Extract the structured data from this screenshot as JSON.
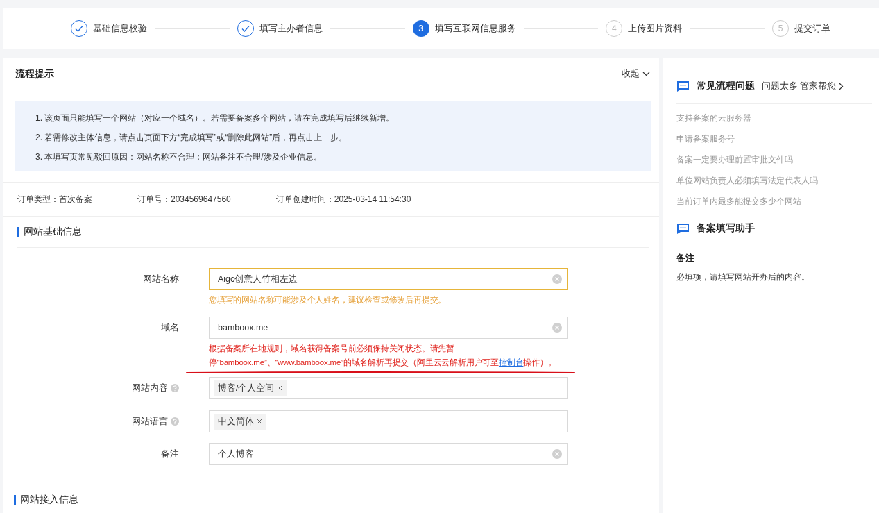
{
  "steps": [
    {
      "label": "基础信息校验",
      "completed": true,
      "selected": false
    },
    {
      "label": "填写主办者信息",
      "completed": true,
      "selected": false
    },
    {
      "number": "3",
      "label": "填写互联网信息服务",
      "completed": false,
      "selected": true
    },
    {
      "number": "4",
      "label": "上传图片资料",
      "completed": false,
      "selected": false
    },
    {
      "number": "5",
      "label": "提交订单",
      "completed": false,
      "selected": false
    }
  ],
  "tips": {
    "title": "流程提示",
    "collapse": "收起",
    "items": [
      "1. 该页面只能填写一个网站（对应一个域名）。若需要备案多个网站，请在完成填写后继续新增。",
      "2. 若需修改主体信息，请点击页面下方“完成填写”或“删除此网站”后，再点击上一步。",
      "3. 本填写页常见驳回原因：网站名称不合理；网站备注不合理/涉及企业信息。"
    ]
  },
  "order": [
    {
      "label": "订单类型：",
      "value": "首次备案"
    },
    {
      "label": "订单号：",
      "value": "2034569647560"
    },
    {
      "label": "订单创建时间：",
      "value": "2025-03-14 11:54:30"
    }
  ],
  "basic_section": {
    "title": "网站基础信息",
    "fields": [
      {
        "kind": "input",
        "label": "网站名称",
        "help": false,
        "value": "Aigc创意人竹相左边",
        "message": {
          "kind": "warning",
          "text": "您填写的网站名称可能涉及个人姓名，建议检查或修改后再提交。"
        }
      },
      {
        "kind": "input",
        "label": "域名",
        "help": false,
        "value": "bamboox.me",
        "message": {
          "kind": "error",
          "text": "根据备案所在地规则，域名获得备案号前必须保持关闭状态。请先暂停“bamboox.me”、“www.bamboox.me”的域名解析再提交（阿里云云解析用户可至",
          "link": "控制台",
          "text_after": "操作）。"
        }
      },
      {
        "kind": "tags",
        "label": "网站内容",
        "help": true,
        "tags": [
          "博客/个人空间"
        ]
      },
      {
        "kind": "tags",
        "label": "网站语言",
        "help": true,
        "tags": [
          "中文简体"
        ]
      },
      {
        "kind": "input",
        "label": "备注",
        "help": false,
        "value": "个人博客"
      }
    ]
  },
  "access_section": {
    "title": "网站接入信息"
  },
  "side": {
    "faq_title": "常见流程问题",
    "faq_link": "问题太多 管家帮您",
    "faq_items": [
      "支持备案的云服务器",
      "申请备案服务号",
      "备案一定要办理前置审批文件吗",
      "单位网站负责人必须填写法定代表人吗",
      "当前订单内最多能提交多少个网站"
    ],
    "helper_title": "备案填写助手",
    "helper_heading": "备注",
    "helper_text": "必填项，请填写网站开办后的内容。"
  }
}
